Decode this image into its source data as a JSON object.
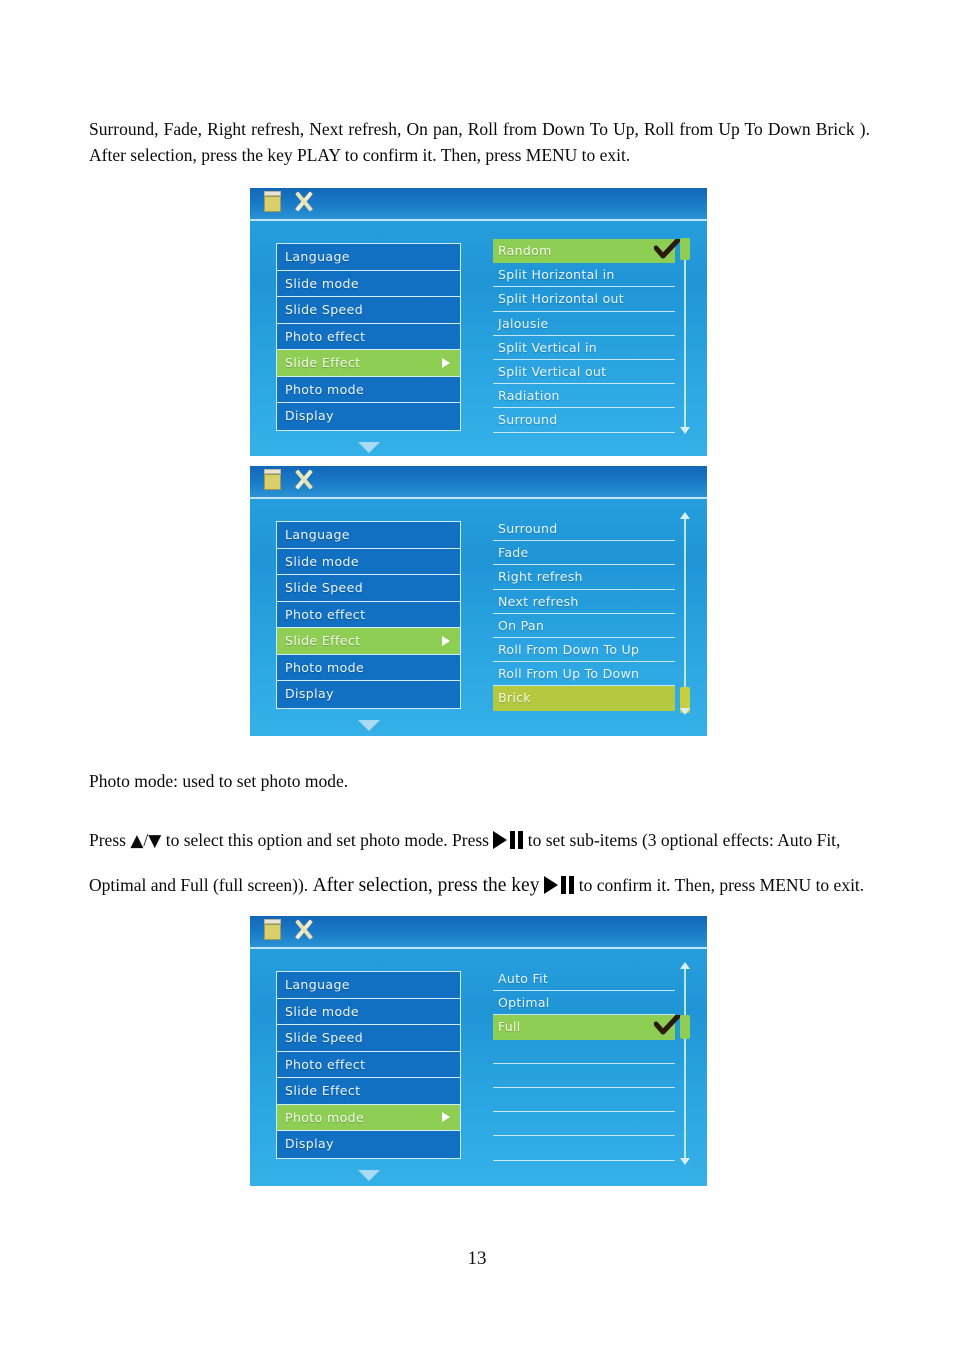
{
  "document": {
    "page_number": "13",
    "intro_paragraph": "Surround, Fade, Right refresh, Next refresh, On pan, Roll from Down To Up, Roll from Up To Down Brick ). After selection, press the key PLAY to confirm it. Then, press MENU to exit.",
    "photo_mode_label": "Photo mode: used to set photo mode.",
    "photo_mode_text": {
      "seg1": "Press ",
      "up_arrow": "▲",
      "slash": "/",
      "down_arrow": "▼",
      "seg2": " to select this option and set photo mode. Press ",
      "seg3": " to set sub-items (3 optional effects: Auto Fit, Optimal and Full (full screen)). ",
      "seg4": "After selection, press the key ",
      "seg5": " to confirm it. Then, press MENU to exit."
    }
  },
  "colors": {
    "screen_blue": "#2aa3e0",
    "menu_blue": "#1170c2",
    "highlight_green": "#8ece55",
    "highlight_olive": "#b4c940",
    "text_white": "#e9f6ff",
    "topbar_blue": "#1167b8"
  },
  "screenshots": [
    {
      "id": "slide-effect-page-1",
      "topbar_icons": [
        "card-icon",
        "tools-icon"
      ],
      "left_menu": [
        {
          "label": "Language",
          "selected": false,
          "has_arrow": false
        },
        {
          "label": "Slide mode",
          "selected": false,
          "has_arrow": false
        },
        {
          "label": "Slide Speed",
          "selected": false,
          "has_arrow": false
        },
        {
          "label": "Photo effect",
          "selected": false,
          "has_arrow": false
        },
        {
          "label": "Slide Effect",
          "selected": true,
          "has_arrow": true
        },
        {
          "label": "Photo mode",
          "selected": false,
          "has_arrow": false
        },
        {
          "label": "Display",
          "selected": false,
          "has_arrow": false
        }
      ],
      "options": [
        {
          "label": "Random",
          "selected": true,
          "checked": true
        },
        {
          "label": "Split Horizontal in",
          "selected": false,
          "checked": false
        },
        {
          "label": "Split Horizontal out",
          "selected": false,
          "checked": false
        },
        {
          "label": "Jalousie",
          "selected": false,
          "checked": false
        },
        {
          "label": "Split Vertical in",
          "selected": false,
          "checked": false
        },
        {
          "label": "Split Vertical out",
          "selected": false,
          "checked": false
        },
        {
          "label": "Radiation",
          "selected": false,
          "checked": false
        },
        {
          "label": "Surround",
          "selected": false,
          "checked": false
        }
      ],
      "scrollbar": {
        "thumb_position": "top",
        "thumb_color": "green"
      }
    },
    {
      "id": "slide-effect-page-2",
      "topbar_icons": [
        "card-icon",
        "tools-icon"
      ],
      "left_menu": [
        {
          "label": "Language",
          "selected": false,
          "has_arrow": false
        },
        {
          "label": "Slide mode",
          "selected": false,
          "has_arrow": false
        },
        {
          "label": "Slide Speed",
          "selected": false,
          "has_arrow": false
        },
        {
          "label": "Photo effect",
          "selected": false,
          "has_arrow": false
        },
        {
          "label": "Slide Effect",
          "selected": true,
          "has_arrow": true
        },
        {
          "label": "Photo mode",
          "selected": false,
          "has_arrow": false
        },
        {
          "label": "Display",
          "selected": false,
          "has_arrow": false
        }
      ],
      "options": [
        {
          "label": "Surround",
          "selected": false,
          "checked": false
        },
        {
          "label": "Fade",
          "selected": false,
          "checked": false
        },
        {
          "label": "Right refresh",
          "selected": false,
          "checked": false
        },
        {
          "label": "Next refresh",
          "selected": false,
          "checked": false
        },
        {
          "label": "On Pan",
          "selected": false,
          "checked": false
        },
        {
          "label": "Roll From Down To Up",
          "selected": false,
          "checked": false
        },
        {
          "label": "Roll From Up To Down",
          "selected": false,
          "checked": false
        },
        {
          "label": "Brick",
          "selected": true,
          "checked": false
        }
      ],
      "scrollbar": {
        "thumb_position": "bottom",
        "thumb_color": "olive"
      }
    },
    {
      "id": "photo-mode-page",
      "topbar_icons": [
        "card-icon",
        "tools-icon"
      ],
      "left_menu": [
        {
          "label": "Language",
          "selected": false,
          "has_arrow": false
        },
        {
          "label": "Slide mode",
          "selected": false,
          "has_arrow": false
        },
        {
          "label": "Slide Speed",
          "selected": false,
          "has_arrow": false
        },
        {
          "label": "Photo effect",
          "selected": false,
          "has_arrow": false
        },
        {
          "label": "Slide Effect",
          "selected": false,
          "has_arrow": false
        },
        {
          "label": "Photo mode",
          "selected": true,
          "has_arrow": true
        },
        {
          "label": "Display",
          "selected": false,
          "has_arrow": false
        }
      ],
      "options": [
        {
          "label": "Auto Fit",
          "selected": false,
          "checked": false
        },
        {
          "label": "Optimal",
          "selected": false,
          "checked": false
        },
        {
          "label": "Full",
          "selected": true,
          "checked": true
        },
        {
          "label": "",
          "selected": false,
          "checked": false
        },
        {
          "label": "",
          "selected": false,
          "checked": false
        },
        {
          "label": "",
          "selected": false,
          "checked": false
        },
        {
          "label": "",
          "selected": false,
          "checked": false
        },
        {
          "label": "",
          "selected": false,
          "checked": false
        }
      ],
      "scrollbar": {
        "thumb_position": "upper",
        "thumb_color": "green"
      }
    }
  ]
}
